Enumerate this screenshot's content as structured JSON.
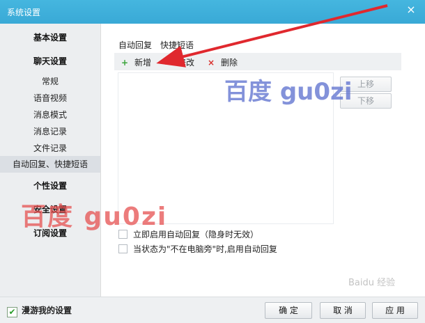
{
  "window": {
    "title": "系统设置",
    "close_label": "×"
  },
  "sidebar": {
    "categories": {
      "basic": "基本设置",
      "chat": "聊天设置",
      "personal": "个性设置",
      "security": "安全设置",
      "subscribe": "订阅设置"
    },
    "chat_items": [
      "常规",
      "语音视频",
      "消息模式",
      "消息记录",
      "文件记录",
      "自动回复、快捷短语"
    ],
    "selected": "自动回复、快捷短语"
  },
  "tabs": [
    "自动回复",
    "快捷短语"
  ],
  "toolbar": {
    "add_icon": "+",
    "add_label": "新增",
    "edit_label": "修改",
    "delete_icon": "×",
    "delete_label": "删除"
  },
  "list_buttons": {
    "up": "上移",
    "down": "下移"
  },
  "options": [
    "立即启用自动回复（隐身时无效）",
    "当状态为\"不在电脑旁\"时,启用自动回复"
  ],
  "bottom": {
    "roam_label": "漫游我的设置",
    "roam_checked": true,
    "ok": "确 定",
    "cancel": "取 消",
    "apply": "应 用"
  },
  "watermarks": {
    "red": "百度 gu0zi",
    "blue": "百度 gu0zi",
    "baidu": "Baidu 经验"
  },
  "colors": {
    "titlebar": "#3fb0db",
    "accent_arrow": "#e0282e",
    "add_icon": "#3aa43a",
    "delete_icon": "#d9302c",
    "checkmark": "#2a9d2a"
  }
}
